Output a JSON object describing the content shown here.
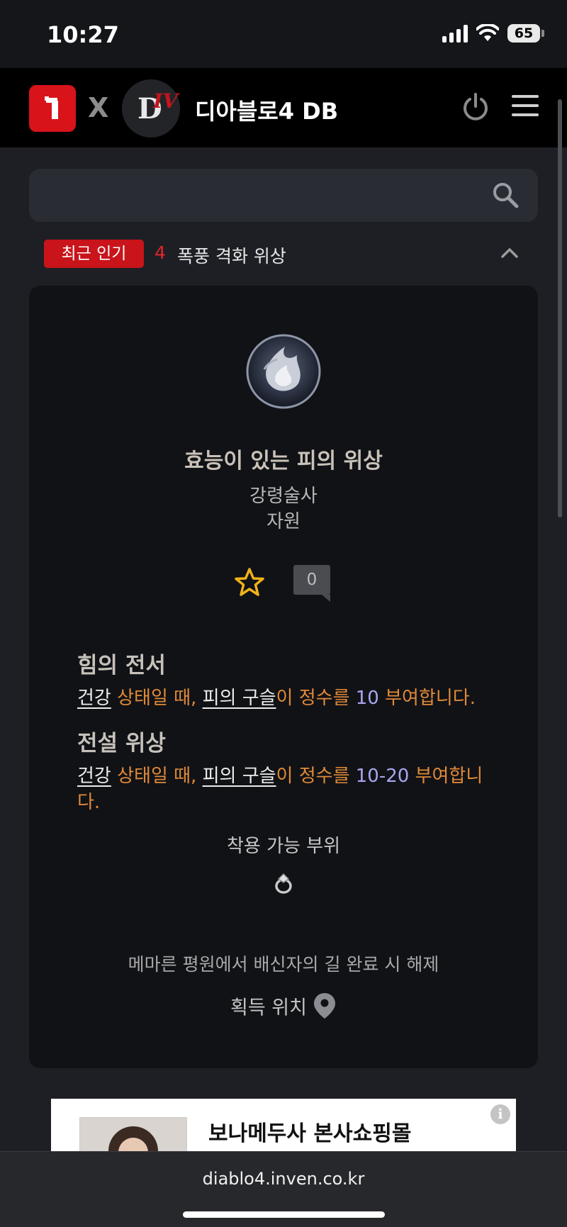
{
  "status_bar": {
    "time": "10:27",
    "battery": "65"
  },
  "header": {
    "x_mark": "X",
    "title": "디아블로4 DB"
  },
  "search": {
    "placeholder": ""
  },
  "trending": {
    "badge": "최근 인기",
    "rank": "4",
    "text": "폭풍 격화 위상"
  },
  "item": {
    "name": "효능이 있는 피의 위상",
    "class": "강령술사",
    "category": "자원",
    "favorite": false,
    "comments": "0",
    "sections": [
      {
        "title": "힘의 전서",
        "keyword1": "건강",
        "text1": " 상태일 때, ",
        "keyword2": "피의 구슬",
        "text2": "이 정수를 ",
        "value": "10",
        "text3": " 부여합니다."
      },
      {
        "title": "전설 위상",
        "keyword1": "건강",
        "text1": " 상태일 때, ",
        "keyword2": "피의 구슬",
        "text2": "이 정수를 ",
        "value": "10-20",
        "text3": " 부여합니다."
      }
    ],
    "equip_label": "착용 가능 부위",
    "equip_slot_icon": "ring-icon",
    "unlock_text": "메마른 평원에서 배신자의 길 완료 시 해제",
    "location_label": "획득 위치"
  },
  "ad": {
    "title": "보나메두사 본사쇼핑몰",
    "info": "i"
  },
  "browser": {
    "url": "diablo4.inven.co.kr"
  },
  "colors": {
    "accent_red": "#c8141a",
    "desc_orange": "#e08a38",
    "value_purple": "#a8a6ef",
    "star_gold": "#f1b21a"
  }
}
